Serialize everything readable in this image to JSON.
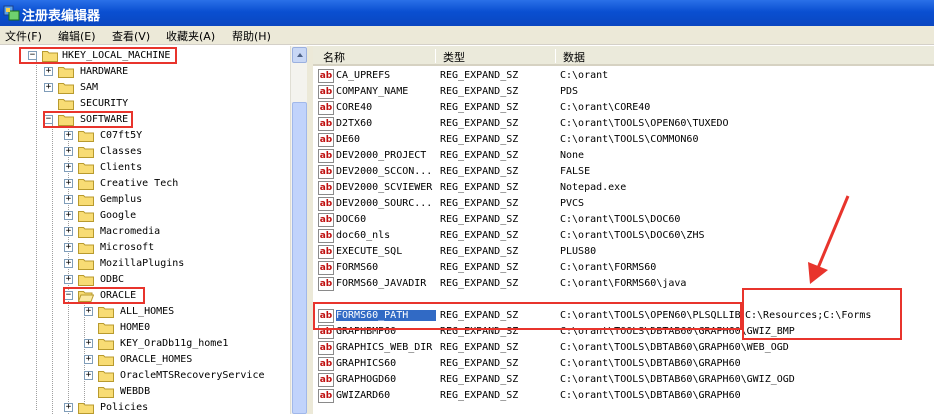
{
  "window": {
    "title": "注册表编辑器"
  },
  "menu": [
    "文件(F)",
    "编辑(E)",
    "查看(V)",
    "收藏夹(A)",
    "帮助(H)"
  ],
  "tree": {
    "root": "HKEY_LOCAL_MACHINE",
    "level1": [
      "HARDWARE",
      "SAM",
      "SECURITY",
      "SOFTWARE"
    ],
    "software_children": [
      "C07ft5Y",
      "Classes",
      "Clients",
      "Creative Tech",
      "Gemplus",
      "Google",
      "Macromedia",
      "Microsoft",
      "MozillaPlugins",
      "ODBC",
      "ORACLE"
    ],
    "oracle_children": [
      "ALL_HOMES",
      "HOME0",
      "KEY_OraDb11g_home1",
      "ORACLE_HOMES",
      "OracleMTSRecoveryService",
      "WEBDB"
    ],
    "after": [
      "Policies"
    ]
  },
  "list": {
    "headers": {
      "name": "名称",
      "type": "类型",
      "data": "数据"
    },
    "icon_label": "ab",
    "rows": [
      {
        "name": "CA_UPREFS",
        "type": "REG_EXPAND_SZ",
        "data": "C:\\orant"
      },
      {
        "name": "COMPANY_NAME",
        "type": "REG_EXPAND_SZ",
        "data": "PDS"
      },
      {
        "name": "CORE40",
        "type": "REG_EXPAND_SZ",
        "data": "C:\\orant\\CORE40"
      },
      {
        "name": "D2TX60",
        "type": "REG_EXPAND_SZ",
        "data": "C:\\orant\\TOOLS\\OPEN60\\TUXEDO"
      },
      {
        "name": "DE60",
        "type": "REG_EXPAND_SZ",
        "data": "C:\\orant\\TOOLS\\COMMON60"
      },
      {
        "name": "DEV2000_PROJECT",
        "type": "REG_EXPAND_SZ",
        "data": "None"
      },
      {
        "name": "DEV2000_SCCON...",
        "type": "REG_EXPAND_SZ",
        "data": "FALSE"
      },
      {
        "name": "DEV2000_SCVIEWER",
        "type": "REG_EXPAND_SZ",
        "data": "Notepad.exe"
      },
      {
        "name": "DEV2000_SOURC...",
        "type": "REG_EXPAND_SZ",
        "data": "PVCS"
      },
      {
        "name": "DOC60",
        "type": "REG_EXPAND_SZ",
        "data": "C:\\orant\\TOOLS\\DOC60"
      },
      {
        "name": "doc60_nls",
        "type": "REG_EXPAND_SZ",
        "data": "C:\\orant\\TOOLS\\DOC60\\ZHS"
      },
      {
        "name": "EXECUTE_SQL",
        "type": "REG_EXPAND_SZ",
        "data": "PLUS80"
      },
      {
        "name": "FORMS60",
        "type": "REG_EXPAND_SZ",
        "data": "C:\\orant\\FORMS60"
      },
      {
        "name": "FORMS60_JAVADIR",
        "type": "REG_EXPAND_SZ",
        "data": "C:\\orant\\FORMS60\\java"
      },
      {
        "name": "FORMS60_PATH",
        "type": "REG_EXPAND_SZ",
        "data": "C:\\orant\\TOOLS\\OPEN60\\PLSQLLIB",
        "extra": "C:\\Resources;C:\\Forms"
      },
      {
        "name": "GRAPHBMP60",
        "type": "REG_EXPAND_SZ",
        "data": "C:\\orant\\TOOLS\\DBTAB60\\GRAPH60\\GWIZ_BMP"
      },
      {
        "name": "GRAPHICS_WEB_DIR",
        "type": "REG_EXPAND_SZ",
        "data": "C:\\orant\\TOOLS\\DBTAB60\\GRAPH60\\WEB_OGD"
      },
      {
        "name": "GRAPHICS60",
        "type": "REG_EXPAND_SZ",
        "data": "C:\\orant\\TOOLS\\DBTAB60\\GRAPH60"
      },
      {
        "name": "GRAPHOGD60",
        "type": "REG_EXPAND_SZ",
        "data": "C:\\orant\\TOOLS\\DBTAB60\\GRAPH60\\GWIZ_OGD"
      },
      {
        "name": "GWIZARD60",
        "type": "REG_EXPAND_SZ",
        "data": "C:\\orant\\TOOLS\\DBTAB60\\GRAPH60"
      }
    ]
  },
  "colors": {
    "highlight": "#e8342c",
    "selection": "#316ac5",
    "titlebar": "#0a4fd1"
  }
}
